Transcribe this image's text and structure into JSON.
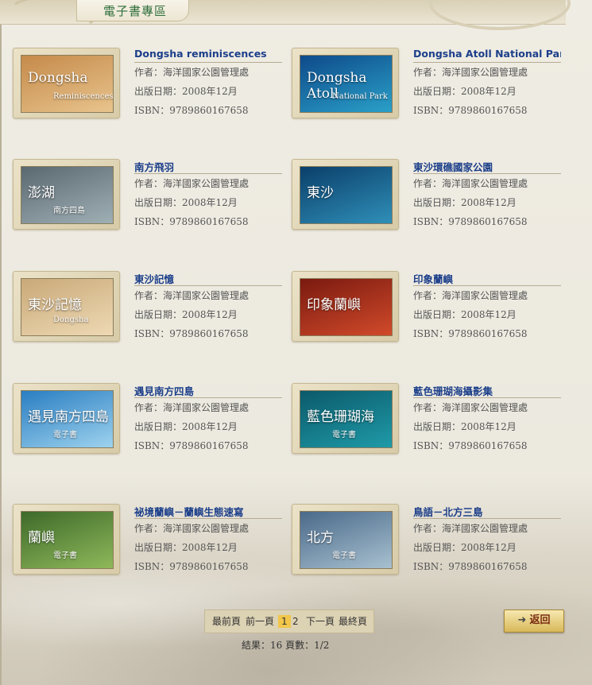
{
  "header": {
    "section_title": "電子書專區"
  },
  "books": [
    {
      "title": "Dongsha reminiscences",
      "author": "作者：海洋國家公園管理處",
      "date": "出版日期：2008年12月",
      "isbn": "ISBN：9789860167658",
      "cover_text": "Dongsha",
      "cover_sub": "Reminiscences",
      "cover_colors": [
        "#c58a4a",
        "#e8c48d"
      ]
    },
    {
      "title": "Dongsha Atoll National Park",
      "author": "作者：海洋國家公園管理處",
      "date": "出版日期：2008年12月",
      "isbn": "ISBN：9789860167658",
      "cover_text": "Dongsha Atoll",
      "cover_sub": "National Park",
      "cover_colors": [
        "#0e4a8a",
        "#2aa0c8"
      ]
    },
    {
      "title": "南方飛羽",
      "author": "作者：海洋國家公園管理處",
      "date": "出版日期：2008年12月",
      "isbn": "ISBN：9789860167658",
      "cover_text": "澎湖",
      "cover_sub": "南方四島",
      "cover_colors": [
        "#5a6870",
        "#9fb0b5"
      ]
    },
    {
      "title": "東沙環礁國家公園",
      "author": "作者：海洋國家公園管理處",
      "date": "出版日期：2008年12月",
      "isbn": "ISBN：9789860167658",
      "cover_text": "東沙",
      "cover_sub": "",
      "cover_colors": [
        "#0a3f6a",
        "#2f8fb8"
      ]
    },
    {
      "title": "東沙記憶",
      "author": "作者：海洋國家公園管理處",
      "date": "出版日期：2008年12月",
      "isbn": "ISBN：9789860167658",
      "cover_text": "東沙記憶",
      "cover_sub": "Dongsha",
      "cover_colors": [
        "#c9a978",
        "#eed9b4"
      ]
    },
    {
      "title": "印象蘭嶼",
      "author": "作者：海洋國家公園管理處",
      "date": "出版日期：2008年12月",
      "isbn": "ISBN：9789860167658",
      "cover_text": "印象蘭嶼",
      "cover_sub": "",
      "cover_colors": [
        "#7a1a10",
        "#d14a2a"
      ]
    },
    {
      "title": "遇見南方四島",
      "author": "作者：海洋國家公園管理處",
      "date": "出版日期：2008年12月",
      "isbn": "ISBN：9789860167658",
      "cover_text": "遇見南方四島",
      "cover_sub": "電子書",
      "cover_colors": [
        "#2a7ec2",
        "#9dd2ee"
      ]
    },
    {
      "title": "藍色珊瑚海攝影集",
      "author": "作者：海洋國家公園管理處",
      "date": "出版日期：2008年12月",
      "isbn": "ISBN：9789860167658",
      "cover_text": "藍色珊瑚海",
      "cover_sub": "電子書",
      "cover_colors": [
        "#0b5a6a",
        "#1f9aa8"
      ]
    },
    {
      "title": "祕境蘭嶼－蘭嶼生態速寫",
      "author": "作者：海洋國家公園管理處",
      "date": "出版日期：2008年12月",
      "isbn": "ISBN：9789860167658",
      "cover_text": "蘭嶼",
      "cover_sub": "電子書",
      "cover_colors": [
        "#3d6a2a",
        "#8fb85a"
      ]
    },
    {
      "title": "鳥語－北方三島",
      "author": "作者：海洋國家公園管理處",
      "date": "出版日期：2008年12月",
      "isbn": "ISBN：9789860167658",
      "cover_text": "北方",
      "cover_sub": "電子書",
      "cover_colors": [
        "#4a6a8a",
        "#a8c0d0"
      ]
    }
  ],
  "pager": {
    "first": "最前頁",
    "prev": "前一頁",
    "page1": "1",
    "page2": "2",
    "next": "下一頁",
    "last": "最終頁"
  },
  "result": "結果：16 頁數：1/2",
  "back_button": {
    "label": "返回",
    "arrow": "➜"
  }
}
